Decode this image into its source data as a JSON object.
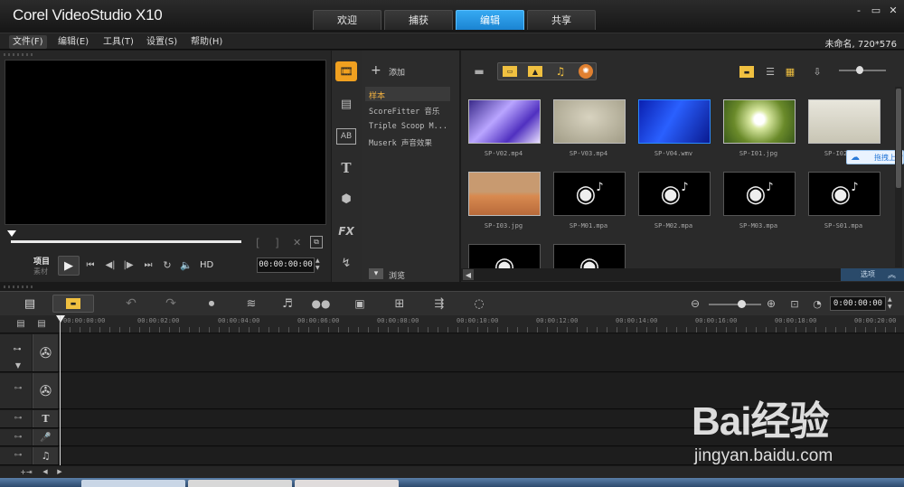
{
  "app": {
    "title": "Corel VideoStudio X10",
    "tabs": [
      {
        "label": "欢迎",
        "active": false
      },
      {
        "label": "捕获",
        "active": false
      },
      {
        "label": "编辑",
        "active": true
      },
      {
        "label": "共享",
        "active": false
      }
    ],
    "window_buttons": [
      "-",
      "▭",
      "✕"
    ]
  },
  "menu": {
    "items": [
      "文件(F)",
      "编辑(E)",
      "工具(T)",
      "设置(S)",
      "帮助(H)"
    ],
    "project_info": "未命名, 720*576"
  },
  "preview": {
    "mode_project": "项目",
    "mode_clip": "素材",
    "quality": "HD",
    "timecode": "00:00:00:00"
  },
  "library": {
    "add_label": "添加",
    "browse_label": "浏览",
    "options_label": "选项",
    "folders": [
      "样本",
      "ScoreFitter 音乐",
      "Triple Scoop M...",
      "Muserk 声音效果"
    ],
    "selected_folder": "样本",
    "items": [
      {
        "name": "SP-V02.mp4",
        "kind": "video",
        "style": "purple"
      },
      {
        "name": "SP-V03.mp4",
        "kind": "video",
        "style": "beige"
      },
      {
        "name": "SP-V04.wmv",
        "kind": "video",
        "style": "blue"
      },
      {
        "name": "SP-I01.jpg",
        "kind": "image",
        "style": "dandelion"
      },
      {
        "name": "SP-I02.jpg",
        "kind": "image",
        "style": "tree"
      },
      {
        "name": "SP-I03.jpg",
        "kind": "image",
        "style": "desert"
      },
      {
        "name": "SP-M01.mpa",
        "kind": "audio",
        "style": "audio"
      },
      {
        "name": "SP-M02.mpa",
        "kind": "audio",
        "style": "audio"
      },
      {
        "name": "SP-M03.mpa",
        "kind": "audio",
        "style": "audio"
      },
      {
        "name": "SP-S01.mpa",
        "kind": "audio",
        "style": "audio"
      },
      {
        "name": "",
        "kind": "audio",
        "style": "audio"
      },
      {
        "name": "",
        "kind": "audio",
        "style": "audio"
      }
    ],
    "baidu_popup": "拖拽上传"
  },
  "timeline": {
    "timecode": "0:00:00:00",
    "ruler_labels": [
      "00:00:00:00",
      "00:00:02:00",
      "00:00:04:00",
      "00:00:06:00",
      "00:00:08:00",
      "00:00:10:00",
      "00:00:12:00",
      "00:00:14:00",
      "00:00:16:00",
      "00:00:18:00",
      "00:00:20:00"
    ],
    "tracks": [
      "video",
      "overlay",
      "title",
      "voice",
      "music"
    ]
  },
  "watermark": {
    "logo": "Bai经验",
    "url": "jingyan.baidu.com"
  },
  "colors": {
    "accent": "#1e8fe0",
    "background": "#1a1a1a",
    "panel": "#262626"
  }
}
